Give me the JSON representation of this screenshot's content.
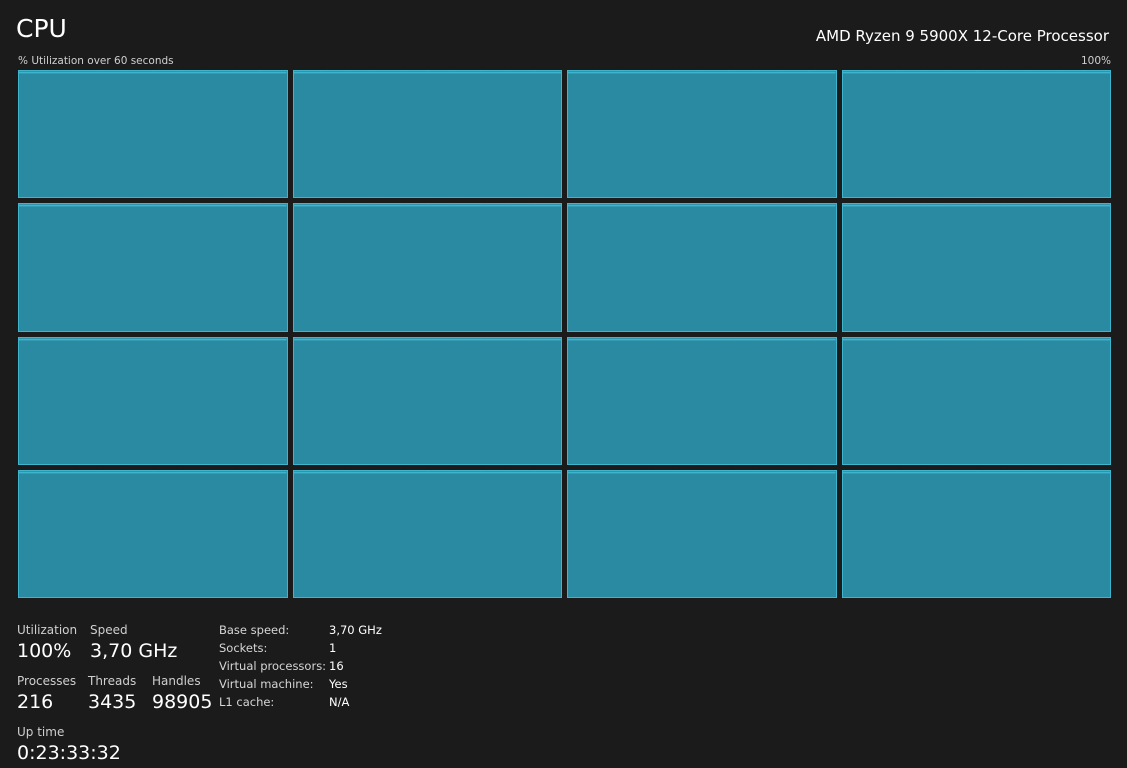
{
  "header": {
    "title": "CPU",
    "processor_name": "AMD Ryzen 9 5900X 12-Core Processor"
  },
  "graph": {
    "utilization_label": "% Utilization over 60 seconds",
    "max_label": "100%",
    "core_count": 16,
    "fill_color": "#2a8aa2",
    "line_color": "#3fb4cd",
    "core_utilization_percent": [
      100,
      100,
      100,
      100,
      100,
      100,
      100,
      100,
      100,
      100,
      100,
      100,
      100,
      100,
      100,
      100
    ]
  },
  "stats": {
    "utilization": {
      "label": "Utilization",
      "value": "100%"
    },
    "speed": {
      "label": "Speed",
      "value": "3,70 GHz"
    },
    "processes": {
      "label": "Processes",
      "value": "216"
    },
    "threads": {
      "label": "Threads",
      "value": "3435"
    },
    "handles": {
      "label": "Handles",
      "value": "98905"
    },
    "uptime": {
      "label": "Up time",
      "value": "0:23:33:32"
    }
  },
  "details": [
    {
      "key": "Base speed:",
      "value": "3,70 GHz"
    },
    {
      "key": "Sockets:",
      "value": "1"
    },
    {
      "key": "Virtual processors:",
      "value": "16"
    },
    {
      "key": "Virtual machine:",
      "value": "Yes"
    },
    {
      "key": "L1 cache:",
      "value": "N/A"
    }
  ]
}
